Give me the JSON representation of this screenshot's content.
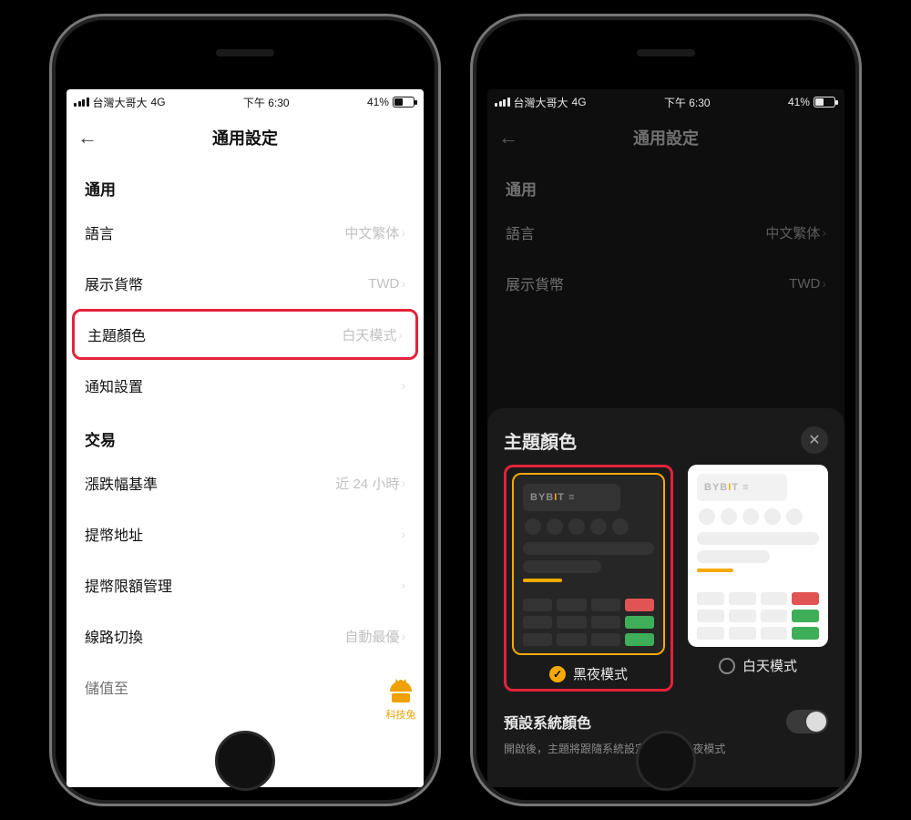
{
  "status": {
    "carrier": "台灣大哥大",
    "network": "4G",
    "time": "下午 6:30",
    "battery_pct": "41%"
  },
  "nav": {
    "title": "通用設定"
  },
  "sections": {
    "general": {
      "title": "通用",
      "language": {
        "label": "語言",
        "value": "中文繁体"
      },
      "currency": {
        "label": "展示貨幣",
        "value": "TWD"
      },
      "theme": {
        "label": "主題顏色",
        "value": "白天模式"
      },
      "notify": {
        "label": "通知設置"
      }
    },
    "trade": {
      "title": "交易",
      "basis": {
        "label": "漲跌幅基準",
        "value": "近 24 小時"
      },
      "withdraw_addr": {
        "label": "提幣地址"
      },
      "withdraw_limit": {
        "label": "提幣限額管理"
      },
      "route": {
        "label": "線路切換",
        "value": "自動最優"
      },
      "store": {
        "label": "儲值至"
      }
    }
  },
  "sheet": {
    "title": "主題顏色",
    "logo_text": "BYBIT",
    "dark_label": "黑夜模式",
    "light_label": "白天模式",
    "sys_title": "預設系統顏色",
    "sys_desc": "開啟後，主題將跟隨系統設定為白天/黑夜模式"
  },
  "watermark": "科技兔"
}
